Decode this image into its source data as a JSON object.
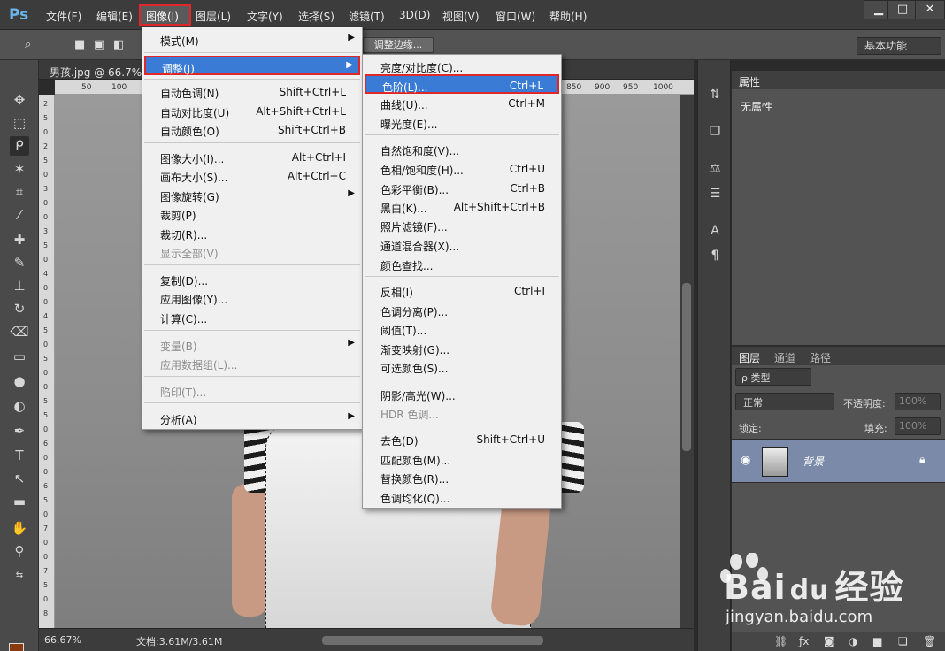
{
  "app": {
    "logo": "Ps"
  },
  "menubar": {
    "items": [
      "文件(F)",
      "编辑(E)",
      "图像(I)",
      "图层(L)",
      "文字(Y)",
      "选择(S)",
      "滤镜(T)",
      "3D(D)",
      "视图(V)",
      "窗口(W)",
      "帮助(H)"
    ],
    "active": "图像(I)",
    "window_buttons": {
      "minimize": "▁",
      "maximize": "□",
      "close": "✕"
    }
  },
  "options_bar": {
    "refine_edge": "调整边缘...",
    "workspace": "基本功能"
  },
  "document": {
    "tab_label": "男孩.jpg @ 66.7%",
    "ruler_marks": [
      "50",
      "100",
      "850",
      "900",
      "950",
      "1000"
    ],
    "ruler_left": [
      "2",
      "5",
      "0",
      "2",
      "5",
      "0",
      "3",
      "0",
      "0",
      "3",
      "5",
      "0",
      "4",
      "0",
      "0",
      "4",
      "5",
      "0",
      "5",
      "0",
      "0",
      "5",
      "5",
      "0",
      "6",
      "0",
      "0",
      "6",
      "5",
      "0",
      "7",
      "0",
      "0",
      "7",
      "5",
      "0",
      "8"
    ]
  },
  "status": {
    "zoom": "66.67%",
    "doc_size": "文档:3.61M/3.61M"
  },
  "properties_panel": {
    "tab": "属性",
    "empty_text": "无属性"
  },
  "layers_panel": {
    "tabs": [
      "图层",
      "通道",
      "路径"
    ],
    "kind_filter": "ρ 类型",
    "blend_mode": "正常",
    "opacity_label": "不透明度:",
    "opacity_value": "100%",
    "lock_label": "锁定:",
    "fill_label": "填充:",
    "fill_value": "100%",
    "layer_name": "背景"
  },
  "image_menu": {
    "items": [
      {
        "label": "模式(M)",
        "submenu": true
      },
      {
        "label": "调整(J)",
        "submenu": true,
        "selected": true
      },
      {
        "label": "自动色调(N)",
        "shortcut": "Shift+Ctrl+L"
      },
      {
        "label": "自动对比度(U)",
        "shortcut": "Alt+Shift+Ctrl+L"
      },
      {
        "label": "自动颜色(O)",
        "shortcut": "Shift+Ctrl+B"
      },
      {
        "label": "图像大小(I)...",
        "shortcut": "Alt+Ctrl+I"
      },
      {
        "label": "画布大小(S)...",
        "shortcut": "Alt+Ctrl+C"
      },
      {
        "label": "图像旋转(G)",
        "submenu": true
      },
      {
        "label": "裁剪(P)"
      },
      {
        "label": "裁切(R)..."
      },
      {
        "label": "显示全部(V)",
        "disabled": true
      },
      {
        "label": "复制(D)..."
      },
      {
        "label": "应用图像(Y)..."
      },
      {
        "label": "计算(C)..."
      },
      {
        "label": "变量(B)",
        "submenu": true,
        "disabled": true
      },
      {
        "label": "应用数据组(L)...",
        "disabled": true
      },
      {
        "label": "陷印(T)...",
        "disabled": true
      },
      {
        "label": "分析(A)",
        "submenu": true
      }
    ]
  },
  "adjust_menu": {
    "items": [
      {
        "label": "亮度/对比度(C)..."
      },
      {
        "label": "色阶(L)...",
        "shortcut": "Ctrl+L",
        "selected": true
      },
      {
        "label": "曲线(U)...",
        "shortcut": "Ctrl+M"
      },
      {
        "label": "曝光度(E)..."
      },
      {
        "label": "自然饱和度(V)..."
      },
      {
        "label": "色相/饱和度(H)...",
        "shortcut": "Ctrl+U"
      },
      {
        "label": "色彩平衡(B)...",
        "shortcut": "Ctrl+B"
      },
      {
        "label": "黑白(K)...",
        "shortcut": "Alt+Shift+Ctrl+B"
      },
      {
        "label": "照片滤镜(F)..."
      },
      {
        "label": "通道混合器(X)..."
      },
      {
        "label": "颜色查找..."
      },
      {
        "label": "反相(I)",
        "shortcut": "Ctrl+I"
      },
      {
        "label": "色调分离(P)..."
      },
      {
        "label": "阈值(T)..."
      },
      {
        "label": "渐变映射(G)..."
      },
      {
        "label": "可选颜色(S)..."
      },
      {
        "label": "阴影/高光(W)..."
      },
      {
        "label": "HDR 色调...",
        "disabled": true
      },
      {
        "label": "去色(D)",
        "shortcut": "Shift+Ctrl+U"
      },
      {
        "label": "匹配颜色(M)..."
      },
      {
        "label": "替换颜色(R)..."
      },
      {
        "label": "色调均化(Q)..."
      }
    ]
  },
  "colors": {
    "foreground": "#8a3a10",
    "background": "#ffffff",
    "highlight": "#3a7bd5",
    "annotation": "#e0282c"
  },
  "watermark": {
    "brand": "Bai",
    "brand2": "经验",
    "url": "jingyan.baidu.com"
  }
}
